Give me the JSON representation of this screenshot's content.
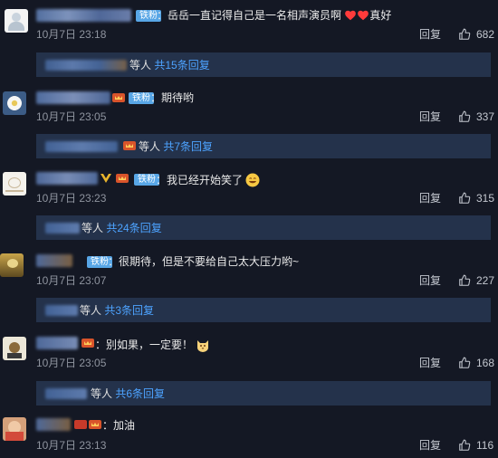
{
  "comments": [
    {
      "name_hidden": true,
      "badge": "铁粉",
      "text_prefix": "：",
      "text": "岳岳一直记得自己是一名相声演员啊",
      "text_suffix": "真好",
      "time": "10月7日 23:18",
      "reply": "回复",
      "likes": "682",
      "sub_suffix": "等人",
      "sub_link": "共15条回复"
    },
    {
      "name_hidden": true,
      "badge": "铁粉",
      "text_prefix": "：",
      "text": "期待哟",
      "time": "10月7日 23:05",
      "reply": "回复",
      "likes": "337",
      "sub_suffix": "等人",
      "sub_link": "共7条回复"
    },
    {
      "name_hidden": true,
      "badge": "铁粉",
      "text_prefix": "：",
      "text": "我已经开始笑了",
      "time": "10月7日 23:23",
      "reply": "回复",
      "likes": "315",
      "sub_suffix": "等人",
      "sub_link": "共24条回复"
    },
    {
      "name_hidden": true,
      "badge": "铁粉",
      "text_prefix": "：",
      "text": "很期待，但是不要给自己太大压力哟~",
      "time": "10月7日 23:07",
      "reply": "回复",
      "likes": "227",
      "sub_suffix": "等人",
      "sub_link": "共3条回复"
    },
    {
      "name_hidden": true,
      "text_prefix": "：",
      "text": "别如果，一定要！",
      "time": "10月7日 23:05",
      "reply": "回复",
      "likes": "168",
      "sub_suffix": "等人",
      "sub_link": "共6条回复"
    },
    {
      "name_hidden": true,
      "text_prefix": "：",
      "text": "加油",
      "time": "10月7日 23:13",
      "reply": "回复",
      "likes": "116"
    }
  ],
  "colors": {
    "background": "#141824",
    "reply_box": "#24324b",
    "link": "#4da3ff",
    "badge": "#58a6e6",
    "heart": "#ff3b3b"
  },
  "icons": [
    "thumbs-up-icon",
    "heart-icon",
    "grin-emoji-icon",
    "cat-emoji-icon",
    "vip-crown-icon"
  ]
}
